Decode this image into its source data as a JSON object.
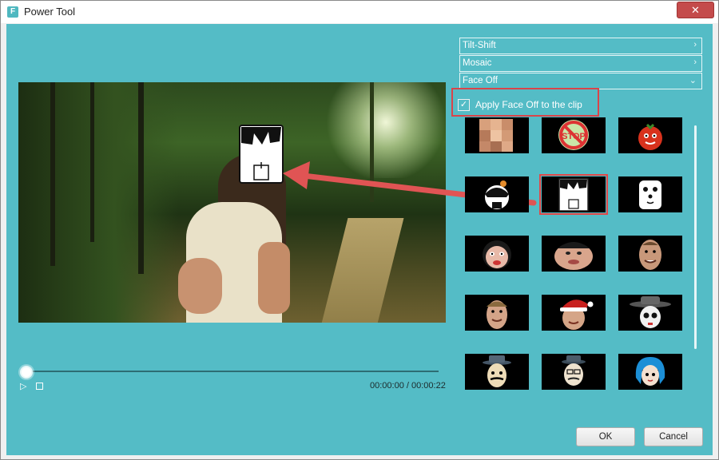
{
  "window": {
    "title": "Power Tool",
    "app_icon_letter": "F",
    "close_glyph": "✕"
  },
  "colors": {
    "panel_bg": "#54bcc6",
    "highlight_red": "#d9444a",
    "arrow_red": "#e05454"
  },
  "accordion": [
    {
      "label": "Tilt-Shift",
      "chevron": "›",
      "expanded": false
    },
    {
      "label": "Mosaic",
      "chevron": "›",
      "expanded": false
    },
    {
      "label": "Face Off",
      "chevron": "⌄",
      "expanded": true
    }
  ],
  "face_off": {
    "apply_label": "Apply Face Off to the clip",
    "apply_checked": true,
    "checkmark_glyph": "✓",
    "selected_index": 4,
    "options": [
      {
        "icon": "pixel-mosaic-face-icon"
      },
      {
        "icon": "stop-sign-face-icon",
        "text": "STOP"
      },
      {
        "icon": "tomato-face-icon"
      },
      {
        "icon": "cartoon-girl-face-icon"
      },
      {
        "icon": "paper-mask-face-icon"
      },
      {
        "icon": "dog-face-icon"
      },
      {
        "icon": "funny-woman-face-icon"
      },
      {
        "icon": "chubby-face-icon"
      },
      {
        "icon": "grinning-man-face-icon"
      },
      {
        "icon": "smiling-man-face-icon"
      },
      {
        "icon": "santa-hat-face-icon"
      },
      {
        "icon": "detective-hat-face-icon"
      },
      {
        "icon": "gangster-hat-face-icon"
      },
      {
        "icon": "mustache-man-face-icon"
      },
      {
        "icon": "blue-hair-girl-face-icon"
      }
    ]
  },
  "player": {
    "play_glyph": "▷",
    "current_time": "00:00:00",
    "total_time": "00:00:22",
    "separator": "/",
    "progress": 0
  },
  "buttons": {
    "ok": "OK",
    "cancel": "Cancel"
  }
}
